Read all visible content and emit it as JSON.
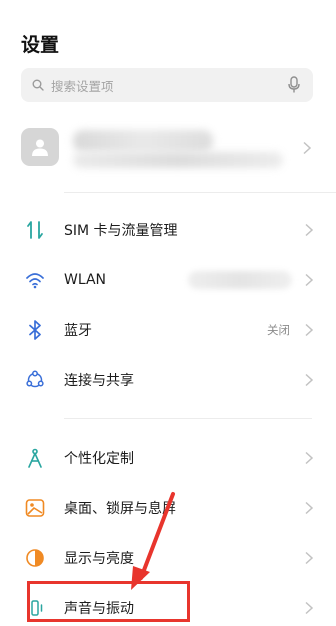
{
  "page": {
    "title": "设置"
  },
  "search": {
    "placeholder": "搜索设置项"
  },
  "account": {},
  "rows": [
    {
      "label": "SIM 卡与流量管理",
      "value": ""
    },
    {
      "label": "WLAN",
      "value": ""
    },
    {
      "label": "蓝牙",
      "value": "关闭"
    },
    {
      "label": "连接与共享",
      "value": ""
    },
    {
      "label": "个性化定制",
      "value": ""
    },
    {
      "label": "桌面、锁屏与息屏",
      "value": ""
    },
    {
      "label": "显示与亮度",
      "value": ""
    },
    {
      "label": "声音与振动",
      "value": ""
    }
  ],
  "icons": {
    "sim": "sim-data-icon",
    "wlan": "wifi-icon",
    "bluetooth": "bluetooth-icon",
    "share": "connection-share-icon",
    "personalize": "personalize-icon",
    "desktop": "desktop-lockscreen-icon",
    "display": "display-brightness-icon",
    "sound": "sound-vibration-icon"
  },
  "colors": {
    "icon_teal": "#2aa6a0",
    "icon_blue": "#3a6fd8",
    "icon_orange": "#f08a24",
    "annotation_red": "#e8352d"
  }
}
